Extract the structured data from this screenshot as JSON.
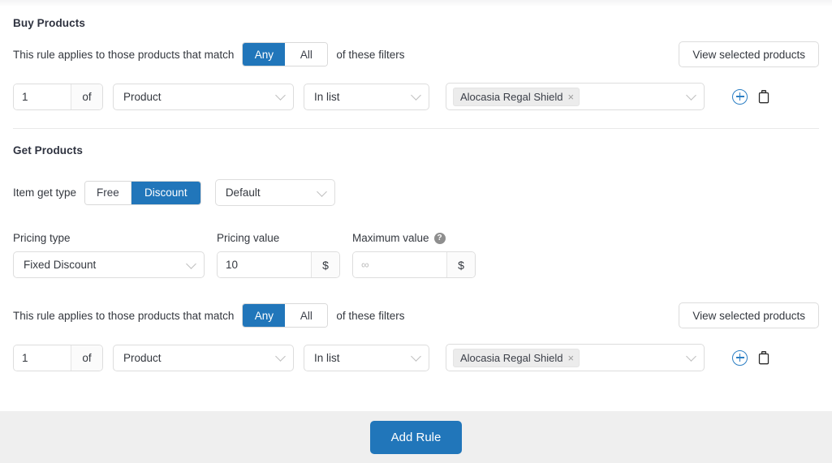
{
  "buy_section": {
    "title": "Buy Products",
    "match_prefix": "This rule applies to those products that match",
    "match_suffix": "of these filters",
    "toggle": {
      "any": "Any",
      "all": "All",
      "selected": "Any"
    },
    "view_selected_label": "View selected products",
    "filter": {
      "quantity": "1",
      "of_label": "of",
      "entity": "Product",
      "operator": "In list",
      "tag": "Alocasia Regal Shield",
      "tag_remove": "×"
    }
  },
  "get_section": {
    "title": "Get Products",
    "item_get_type_label": "Item get type",
    "type_toggle": {
      "free": "Free",
      "discount": "Discount",
      "selected": "Discount"
    },
    "mode_select": "Default",
    "pricing_type_label": "Pricing type",
    "pricing_type_value": "Fixed Discount",
    "pricing_value_label": "Pricing value",
    "pricing_value": "10",
    "pricing_currency": "$",
    "maximum_value_label": "Maximum value",
    "maximum_value_placeholder": "∞",
    "maximum_currency": "$",
    "help_glyph": "?",
    "match_prefix": "This rule applies to those products that match",
    "match_suffix": "of these filters",
    "toggle": {
      "any": "Any",
      "all": "All",
      "selected": "Any"
    },
    "view_selected_label": "View selected products",
    "filter": {
      "quantity": "1",
      "of_label": "of",
      "entity": "Product",
      "operator": "In list",
      "tag": "Alocasia Regal Shield",
      "tag_remove": "×"
    }
  },
  "footer": {
    "add_rule_label": "Add Rule"
  },
  "colors": {
    "accent": "#2176ba",
    "footer_bg": "#efefef",
    "border": "#dddddd",
    "chip_bg": "#ececec"
  }
}
